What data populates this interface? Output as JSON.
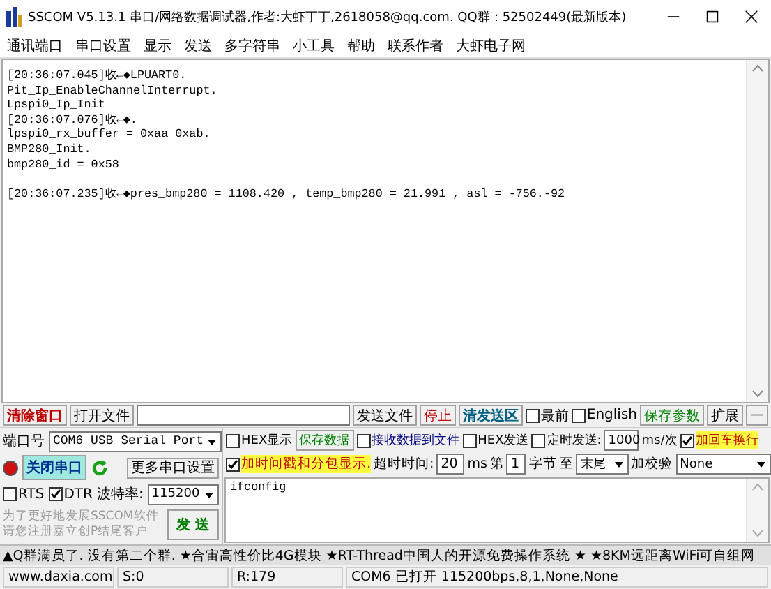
{
  "window": {
    "title": "SSCOM V5.13.1 串口/网络数据调试器,作者:大虾丁丁,2618058@qq.com. QQ群：52502449(最新版本)"
  },
  "menu": [
    "通讯端口",
    "串口设置",
    "显示",
    "发送",
    "多字符串",
    "小工具",
    "帮助",
    "联系作者",
    "大虾电子网"
  ],
  "log": [
    {
      "text": "[20:36:07.045]收←◆LPUART0.",
      "blank_before": false
    },
    {
      "text": "Pit_Ip_EnableChannelInterrupt.",
      "blank_before": false
    },
    {
      "text": "Lpspi0_Ip_Init",
      "blank_before": false
    },
    {
      "text": "[20:36:07.076]收←◆.",
      "blank_before": false
    },
    {
      "text": "lpspi0_rx_buffer = 0xaa 0xab.",
      "blank_before": false
    },
    {
      "text": "BMP280_Init.",
      "blank_before": false
    },
    {
      "text": "bmp280_id = 0x58",
      "blank_before": false
    },
    {
      "text": "[20:36:07.235]收←◆pres_bmp280 = 1108.420 , temp_bmp280 = 21.991 , asl = -756.-92",
      "blank_before": true
    }
  ],
  "toolbar": {
    "clear_button": "清除窗口",
    "open_file_button": "打开文件",
    "send_file_button": "发送文件",
    "stop_button": "停止",
    "clear_send_button": "清发送区",
    "checks": [
      {
        "label": "最前",
        "checked": false
      },
      {
        "label": "English",
        "checked": false
      }
    ],
    "save_params_button": "保存参数",
    "expand_button": "扩展",
    "collapse_button": "—"
  },
  "port_panel": {
    "port_label": "端口号",
    "port": "COM6 USB Serial Port",
    "port_open": true,
    "close_port_button": "关闭串口",
    "more_settings_button": "更多串口设置",
    "lines": [
      {
        "label": "RTS",
        "checked": false
      },
      {
        "label": "DTR",
        "checked": true
      }
    ],
    "baud_label": "波特率:",
    "baud": "115200",
    "promo": [
      "为了更好地发展SSCOM软件",
      "请您注册嘉立创P结尾客户"
    ],
    "send_button": "发 送"
  },
  "options": {
    "hex_display": {
      "label": "HEX显示",
      "checked": false
    },
    "save_data_button": "保存数据",
    "recv_to_file": {
      "label": "接收数据到文件",
      "checked": false
    },
    "hex_send": {
      "label": "HEX发送",
      "checked": false
    },
    "timed_send": {
      "label": "定时发送:",
      "checked": false
    },
    "interval": "1000",
    "interval_unit": "ms/次",
    "add_crlf": {
      "label": "加回车换行",
      "checked": true
    },
    "timestamp": {
      "label": "加时间戳和分包显示.",
      "checked": true
    },
    "timeout_label": "超时时间:",
    "timeout": "20",
    "timeout_unit": "ms",
    "from_label": "第",
    "from": "1",
    "byte_label": "字节",
    "to_label": "至",
    "to": "末尾",
    "checksum_label": "加校验",
    "checksum": "None"
  },
  "send_text": "ifconfig",
  "ticker": "▲Q群满员了. 没有第二个群. ★合宙高性价比4G模块 ★RT-Thread中国人的开源免费操作系统 ★ ★8KM远距离WiFi可自组网",
  "status_bar": [
    "www.daxia.com",
    "S:0",
    "R:179",
    "COM6 已打开  115200bps,8,1,None,None"
  ]
}
